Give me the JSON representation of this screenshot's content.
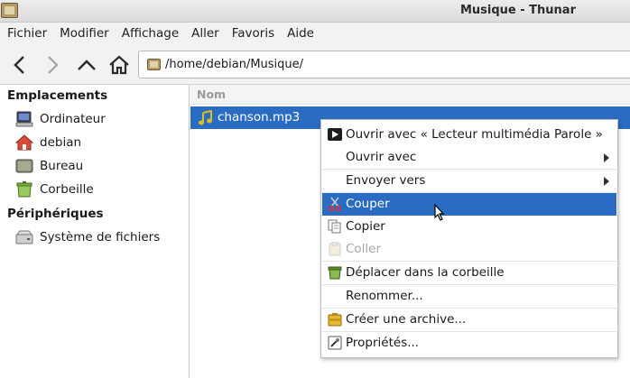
{
  "window": {
    "title": "Musique - Thunar"
  },
  "menubar": [
    "Fichier",
    "Modifier",
    "Affichage",
    "Aller",
    "Favoris",
    "Aide"
  ],
  "toolbar": {
    "back_icon": "chevron-left-icon",
    "forward_icon": "chevron-right-icon",
    "up_icon": "chevron-up-icon",
    "home_icon": "home-icon",
    "location": "/home/debian/Musique/"
  },
  "sidebar": {
    "places_heading": "Emplacements",
    "places": [
      {
        "label": "Ordinateur",
        "icon": "computer-icon"
      },
      {
        "label": "debian",
        "icon": "home-folder-icon"
      },
      {
        "label": "Bureau",
        "icon": "desktop-icon"
      },
      {
        "label": "Corbeille",
        "icon": "trash-icon"
      }
    ],
    "devices_heading": "Périphériques",
    "devices": [
      {
        "label": "Système de fichiers",
        "icon": "drive-icon"
      }
    ]
  },
  "file_list": {
    "column_name": "Nom",
    "files": [
      {
        "name": "chanson.mp3",
        "icon": "audio-file-icon",
        "selected": true
      }
    ]
  },
  "context_menu": {
    "items": [
      {
        "label": "Ouvrir avec « Lecteur multimédia Parole »",
        "icon": "play-icon"
      },
      {
        "label": "Ouvrir avec",
        "submenu": true
      },
      {
        "label": "Envoyer vers",
        "submenu": true
      },
      {
        "label": "Couper",
        "icon": "scissors-icon",
        "highlighted": true
      },
      {
        "label": "Copier",
        "icon": "copy-icon"
      },
      {
        "label": "Coller",
        "icon": "paste-icon",
        "disabled": true
      },
      {
        "label": "Déplacer dans la corbeille",
        "icon": "trash-icon"
      },
      {
        "label": "Renommer..."
      },
      {
        "label": "Créer une archive...",
        "icon": "archive-icon"
      },
      {
        "label": "Propriétés...",
        "icon": "properties-icon"
      }
    ]
  },
  "colors": {
    "selection": "#2a6cc4",
    "menubar_bg": "#f2f2f2"
  }
}
